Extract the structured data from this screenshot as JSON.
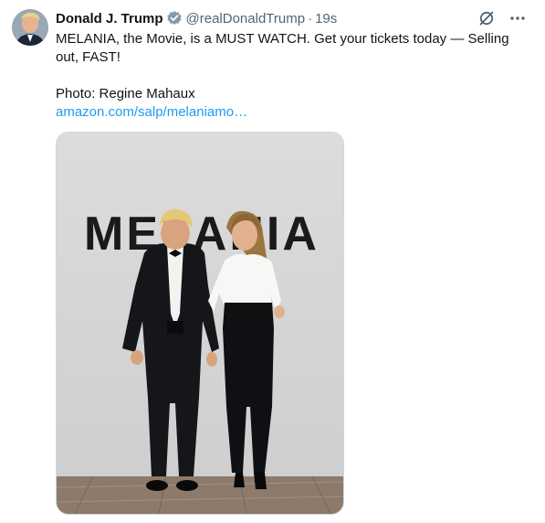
{
  "tweet": {
    "author_name": "Donald J. Trump",
    "handle": "@realDonaldTrump",
    "separator": "·",
    "time": "19s",
    "text": "MELANIA, the Movie, is a MUST WATCH. Get your tickets today — Selling out, FAST!",
    "credit": "Photo: Regine Mahaux",
    "link": "amazon.com/salp/melaniamo…",
    "photo_backdrop_text": "MELANIA"
  },
  "icons": {
    "verified": "verified-badge-icon",
    "grok": "grok-icon",
    "more": "more-icon"
  },
  "colors": {
    "link": "#1d9bf0",
    "verified": "#829aab",
    "secondary_text": "#536471"
  }
}
